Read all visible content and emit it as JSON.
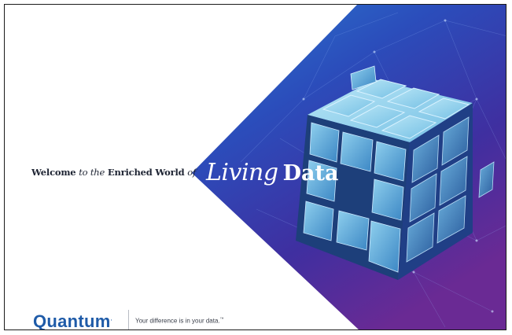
{
  "welcome": {
    "part1": "Welcome ",
    "part2": "to the",
    "part3": " Enriched World ",
    "part4": "of"
  },
  "headline": {
    "word1": "Living",
    "word2": "Data"
  },
  "brand": {
    "logo_text": "Quantum",
    "logo_mark": ".",
    "tagline": "Your difference is in your data.",
    "tagline_mark": "™"
  },
  "colors": {
    "navy": "#1e2433",
    "brand_blue": "#1f5ba8",
    "art_blue": "#2a47b8",
    "art_purple": "#5b2a8f",
    "cube_cyan": "#7fc8ea"
  },
  "icons": {
    "art": "cube-network-art"
  }
}
